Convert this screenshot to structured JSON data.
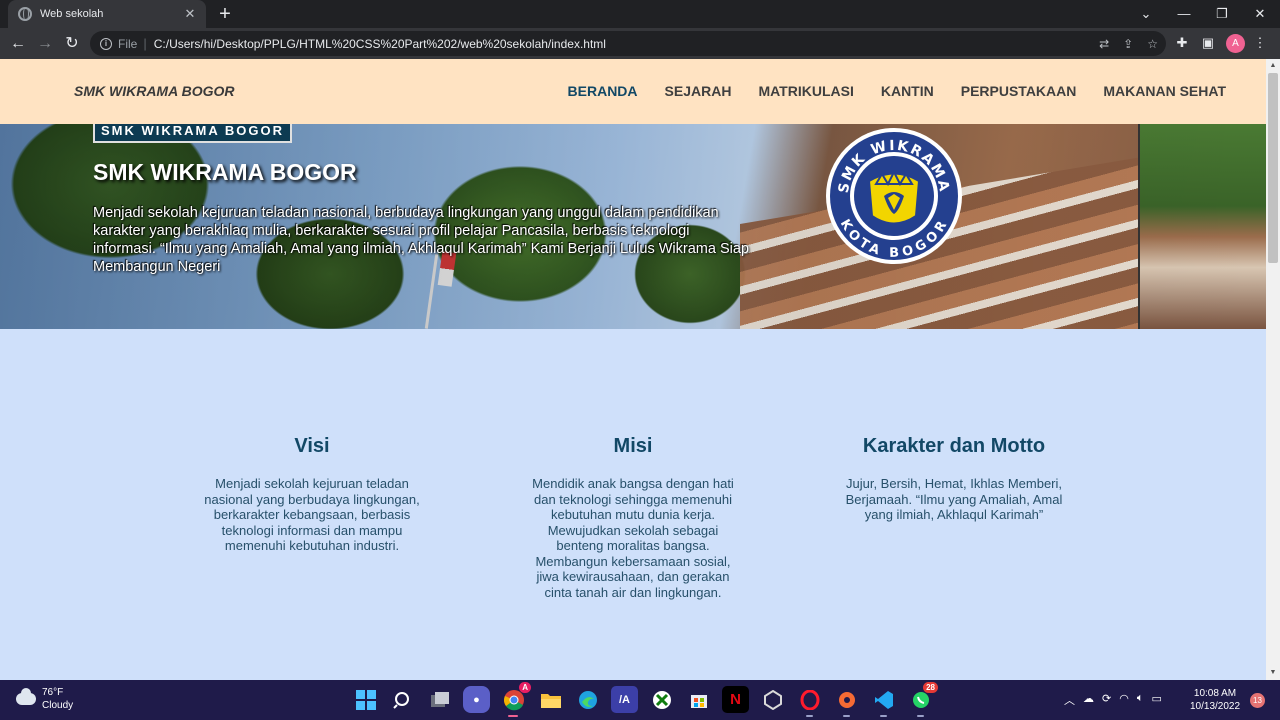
{
  "browser": {
    "tab_title": "Web sekolah",
    "new_tab": "+",
    "file_label": "File",
    "url": "C:/Users/hi/Desktop/PPLG/HTML%20CSS%20Part%202/web%20sekolah/index.html",
    "profile_initial": "A"
  },
  "site": {
    "brand": "SMK WIKRAMA BOGOR",
    "menu": [
      "BERANDA",
      "SEJARAH",
      "MATRIKULASI",
      "KANTIN",
      "PERPUSTAKAAN",
      "MAKANAN SEHAT"
    ],
    "active_menu": "BERANDA"
  },
  "hero": {
    "badge": "SMK WIKRAMA BOGOR",
    "title": "SMK WIKRAMA BOGOR",
    "description": "Menjadi sekolah kejuruan teladan nasional, berbudaya lingkungan yang unggul dalam pendidikan karakter yang berakhlaq mulia, berkarakter sesuai profil pelajar Pancasila, berbasis teknologi informasi. “Ilmu yang Amaliah, Amal yang ilmiah, Akhlaqul Karimah” Kami Berjanji Lulus Wikrama Siap Membangun Negeri",
    "logo_top_text": "SMK WIKRAMA",
    "logo_bottom_text": "KOTA BOGOR"
  },
  "columns": {
    "visi": {
      "title": "Visi",
      "body": "Menjadi sekolah kejuruan teladan nasional yang berbudaya lingkungan, berkarakter kebangsaan, berbasis teknologi informasi dan mampu memenuhi kebutuhan industri."
    },
    "misi": {
      "title": "Misi",
      "body": "Mendidik anak bangsa dengan hati dan teknologi sehingga memenuhi kebutuhan mutu dunia kerja. Mewujudkan sekolah sebagai benteng moralitas bangsa. Membangun kebersamaan sosial, jiwa kewirausahaan, dan gerakan cinta tanah air dan lingkungan."
    },
    "motto": {
      "title": "Karakter dan Motto",
      "body": "Jujur, Bersih, Hemat, Ikhlas Memberi, Berjamaah. “Ilmu yang Amaliah, Amal yang ilmiah, Akhlaqul Karimah”"
    }
  },
  "taskbar": {
    "temperature": "76°F",
    "condition": "Cloudy",
    "time": "10:08 AM",
    "date": "10/13/2022",
    "notifications": "13",
    "whatsapp_badge": "28",
    "chrome_badge": "A"
  },
  "colors": {
    "nav_bg": "#ffe3c2",
    "page_bg": "#cfe0fa",
    "accent": "#124866",
    "taskbar_bg": "#1f1b4a"
  }
}
